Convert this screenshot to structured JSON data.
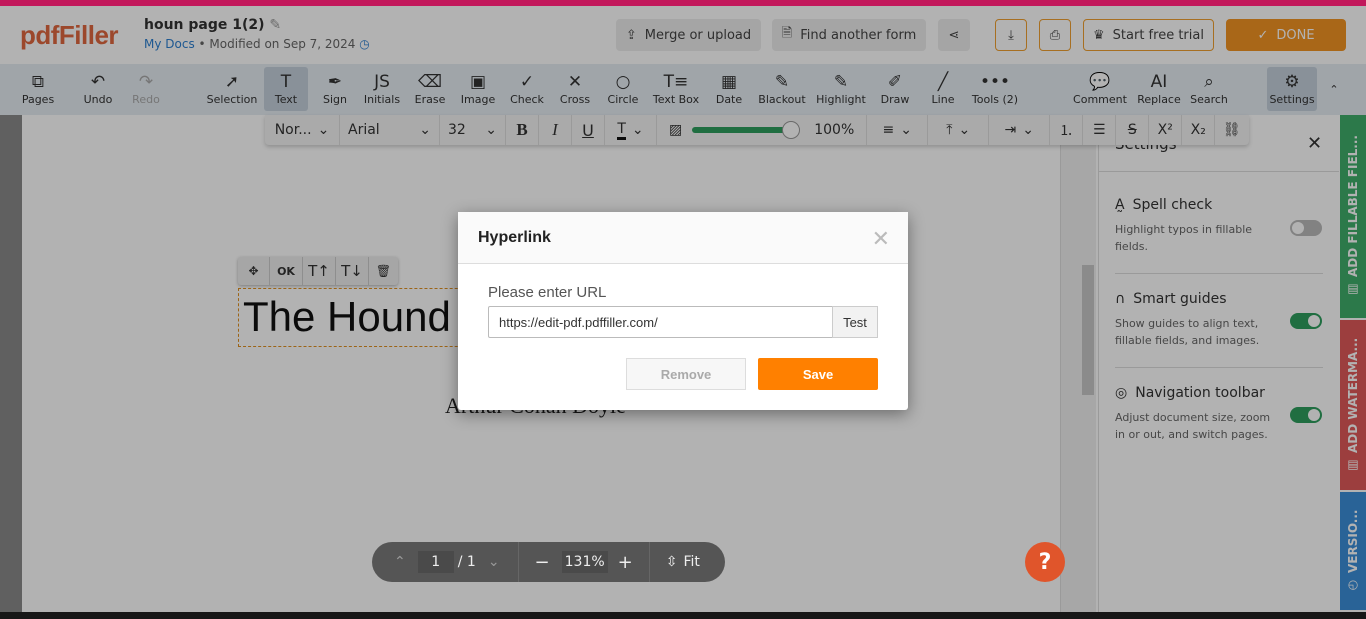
{
  "header": {
    "logo": "pdfFiller",
    "doc_title": "houn page 1(2)",
    "my_docs": "My Docs",
    "modified": "Modified on Sep 7, 2024",
    "merge": "Merge or upload",
    "find": "Find another form",
    "trial": "Start free trial",
    "done": "DONE"
  },
  "toolbar": [
    {
      "label": "Pages",
      "icon": "⧉"
    },
    {
      "label": "Undo",
      "icon": "↶"
    },
    {
      "label": "Redo",
      "icon": "↷"
    },
    {
      "label": "Selection",
      "icon": "➚"
    },
    {
      "label": "Text",
      "icon": "T"
    },
    {
      "label": "Sign",
      "icon": "✒"
    },
    {
      "label": "Initials",
      "icon": "JS"
    },
    {
      "label": "Erase",
      "icon": "⌫"
    },
    {
      "label": "Image",
      "icon": "▣"
    },
    {
      "label": "Check",
      "icon": "✓"
    },
    {
      "label": "Cross",
      "icon": "✕"
    },
    {
      "label": "Circle",
      "icon": "○"
    },
    {
      "label": "Text Box",
      "icon": "T≡"
    },
    {
      "label": "Date",
      "icon": "▦"
    },
    {
      "label": "Blackout",
      "icon": "✎"
    },
    {
      "label": "Highlight",
      "icon": "✎"
    },
    {
      "label": "Draw",
      "icon": "✐"
    },
    {
      "label": "Line",
      "icon": "╱"
    },
    {
      "label": "Tools (2)",
      "icon": "•••"
    },
    {
      "label": "Comment",
      "icon": "💬"
    },
    {
      "label": "Replace",
      "icon": "AI"
    },
    {
      "label": "Search",
      "icon": "⌕"
    },
    {
      "label": "Settings",
      "icon": "⚙"
    }
  ],
  "format": {
    "style": "Nor...",
    "font": "Arial",
    "size": "32",
    "opacity": "100%",
    "opacity_value": 100
  },
  "document": {
    "title_text": "The Hound",
    "author": "Arthur Conan Doyle",
    "ok": "OK"
  },
  "settings": {
    "title": "Settings",
    "items": [
      {
        "title": "Spell check",
        "desc": "Highlight typos in fillable fields.",
        "on": false
      },
      {
        "title": "Smart guides",
        "desc": "Show guides to align text, fillable fields, and images.",
        "on": true
      },
      {
        "title": "Navigation toolbar",
        "desc": "Adjust document size, zoom in or out, and switch pages.",
        "on": true
      }
    ]
  },
  "sidetabs": [
    {
      "label": "ADD FILLABLE FIEL...",
      "color": "#3fae6a"
    },
    {
      "label": "ADD WATERMA...",
      "color": "#e05a5a"
    },
    {
      "label": "VERSIO...",
      "color": "#3b8fd9"
    }
  ],
  "nav": {
    "page": "1",
    "total": "/ 1",
    "zoom": "131%",
    "fit": "Fit"
  },
  "help": "?",
  "modal": {
    "title": "Hyperlink",
    "label": "Please enter URL",
    "url": "https://edit-pdf.pdffiller.com/",
    "test": "Test",
    "remove": "Remove",
    "save": "Save"
  }
}
